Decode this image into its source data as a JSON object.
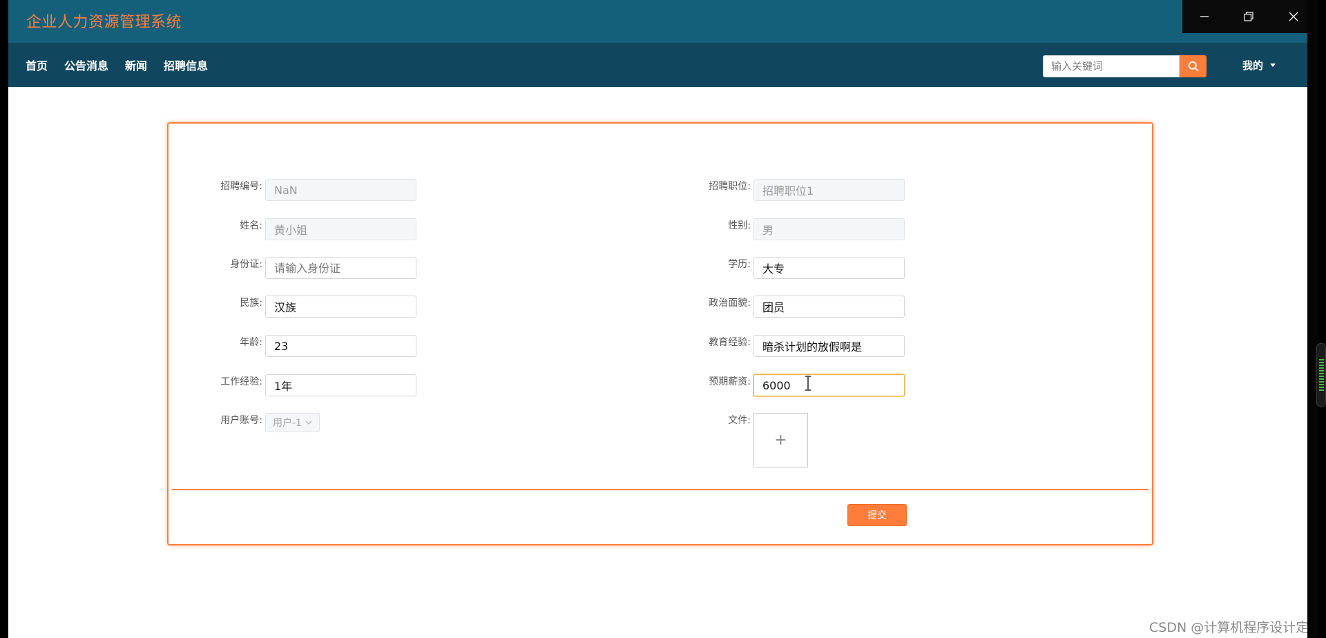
{
  "app": {
    "title": "企业人力资源管理系统"
  },
  "nav": {
    "links": [
      "首页",
      "公告消息",
      "新闻",
      "招聘信息"
    ],
    "search_placeholder": "输入关键词",
    "user_label": "我的"
  },
  "form": {
    "left": [
      {
        "label": "招聘编号:",
        "value": "NaN",
        "state": "disabled"
      },
      {
        "label": "姓名:",
        "value": "黄小姐",
        "state": "disabled"
      },
      {
        "label": "身份证:",
        "value": "",
        "placeholder": "请输入身份证",
        "state": "normal"
      },
      {
        "label": "民族:",
        "value": "汉族",
        "state": "normal"
      },
      {
        "label": "年龄:",
        "value": "23",
        "state": "normal"
      },
      {
        "label": "工作经验:",
        "value": "1年",
        "state": "normal"
      }
    ],
    "right": [
      {
        "label": "招聘职位:",
        "value": "招聘职位1",
        "state": "disabled"
      },
      {
        "label": "性别:",
        "value": "男",
        "state": "disabled"
      },
      {
        "label": "学历:",
        "value": "大专",
        "state": "normal"
      },
      {
        "label": "政治面貌:",
        "value": "团员",
        "state": "normal"
      },
      {
        "label": "教育经验:",
        "value": "暗杀计划的放假啊是",
        "state": "normal"
      },
      {
        "label": "预期薪资:",
        "value": "6000",
        "state": "focused"
      }
    ],
    "account": {
      "label": "用户账号:",
      "value": "用户-1"
    },
    "file": {
      "label": "文件:",
      "add_symbol": "+"
    },
    "submit_label": "提交"
  },
  "watermark": "CSDN @计算机程序设计定制"
}
